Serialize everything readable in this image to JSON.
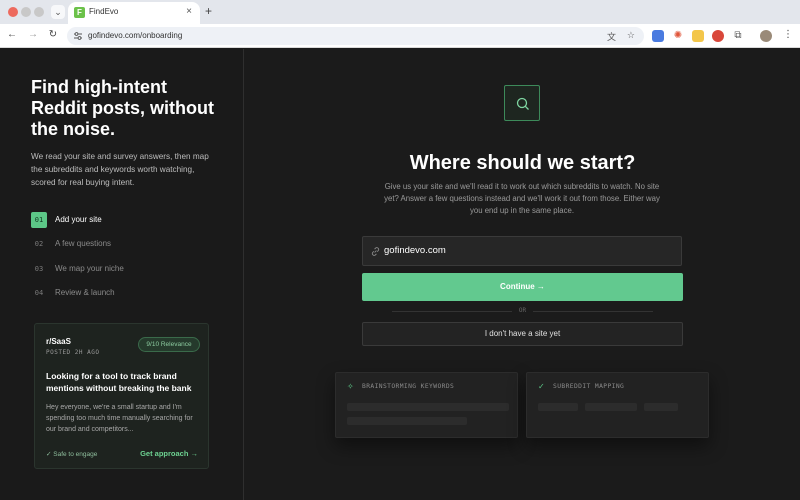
{
  "browser": {
    "tab_title": "FindEvo",
    "tab_favicon_letter": "F",
    "url": "gofindevo.com/onboarding",
    "new_tab_glyph": "+",
    "close_glyph": "×"
  },
  "left": {
    "headline": "Find high-intent Reddit posts, without the noise.",
    "subcopy": "We read your site and survey answers, then map the subreddits and keywords worth watching, scored for real buying intent.",
    "steps": [
      {
        "num": "01",
        "label": "Add your site",
        "active": true
      },
      {
        "num": "02",
        "label": "A few questions",
        "active": false
      },
      {
        "num": "03",
        "label": "We map your niche",
        "active": false
      },
      {
        "num": "04",
        "label": "Review & launch",
        "active": false
      }
    ],
    "post": {
      "subreddit": "r/SaaS",
      "time": "POSTED 2H AGO",
      "relevance": "9/10 Relevance",
      "title": "Looking for a tool to track brand mentions without breaking the bank",
      "body": "Hey everyone, we're a small startup and I'm spending too much time manually searching for our brand and competitors...",
      "status": "✓  Safe to engage",
      "action": "Get approach →"
    }
  },
  "main": {
    "title": "Where should we start?",
    "description": "Give us your site and we'll read it to work out which subreddits to watch. No site yet? Answer a few questions instead and we'll work it out from those. Either way you end up in the same place.",
    "url_value": "gofindevo.com",
    "continue_label": "Continue  →",
    "or_label": "OR",
    "no_site_label": "I don't have a site yet",
    "feature_cards": [
      {
        "icon": "✧",
        "label": "BRAINSTORMING KEYWORDS"
      },
      {
        "icon": "✓",
        "label": "SUBREDDIT MAPPING"
      }
    ]
  },
  "colors": {
    "accent": "#62c98f",
    "background": "#1b1b1b"
  }
}
